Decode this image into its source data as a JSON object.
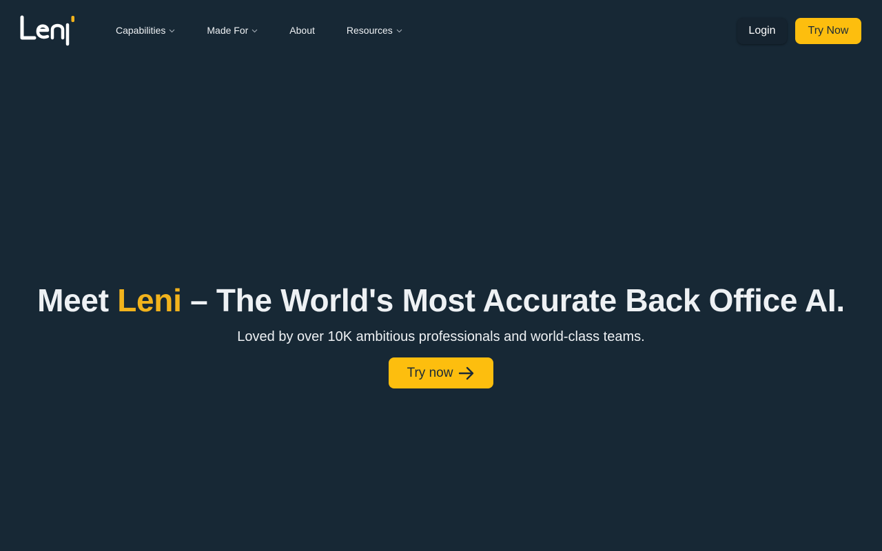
{
  "brand": {
    "logo_text": "Leni",
    "accent_color": "#f2b31c"
  },
  "nav": {
    "items": [
      {
        "label": "Capabilities",
        "has_dropdown": true
      },
      {
        "label": "Made For",
        "has_dropdown": true
      },
      {
        "label": "About",
        "has_dropdown": false
      },
      {
        "label": "Resources",
        "has_dropdown": true
      }
    ],
    "login_label": "Login",
    "try_now_label": "Try Now"
  },
  "hero": {
    "title_prefix": "Meet ",
    "title_accent": "Leni",
    "title_suffix": " – The World's Most Accurate Back Office AI.",
    "subtitle": "Loved by over 10K ambitious professionals and world-class teams.",
    "cta_label": "Try now",
    "cta_icon": "arrow-right-icon"
  },
  "colors": {
    "background": "#172835",
    "button_primary": "#fdbe0e",
    "text": "#eef1f4"
  }
}
